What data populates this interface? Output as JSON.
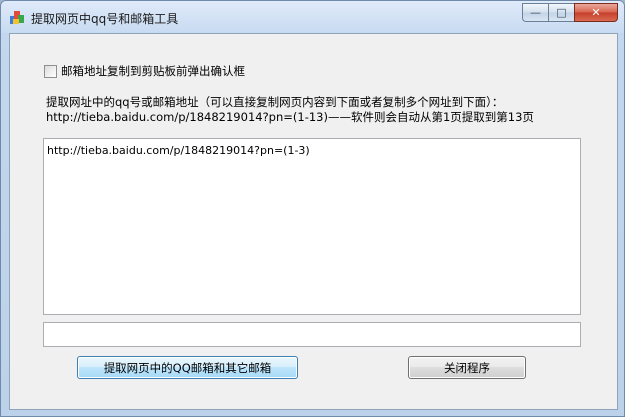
{
  "window": {
    "title": "提取网页中qq号和邮箱工具",
    "controls": {
      "minimize": "—",
      "maximize": "□",
      "close": "✕"
    }
  },
  "form": {
    "checkbox_label": "邮箱地址复制到剪贴板前弹出确认框",
    "checkbox_checked": false,
    "instruction_line1": "提取网址中的qq号或邮箱地址（可以直接复制网页内容到下面或者复制多个网址到下面）：",
    "instruction_line2": "http://tieba.baidu.com/p/1848219014?pn=(1-13)——软件则会自动从第1页提取到第13页",
    "url_input_value": "http://tieba.baidu.com/p/1848219014?pn=(1-3)",
    "output_value": ""
  },
  "buttons": {
    "extract": "提取网页中的QQ邮箱和其它邮箱",
    "close": "关闭程序"
  }
}
